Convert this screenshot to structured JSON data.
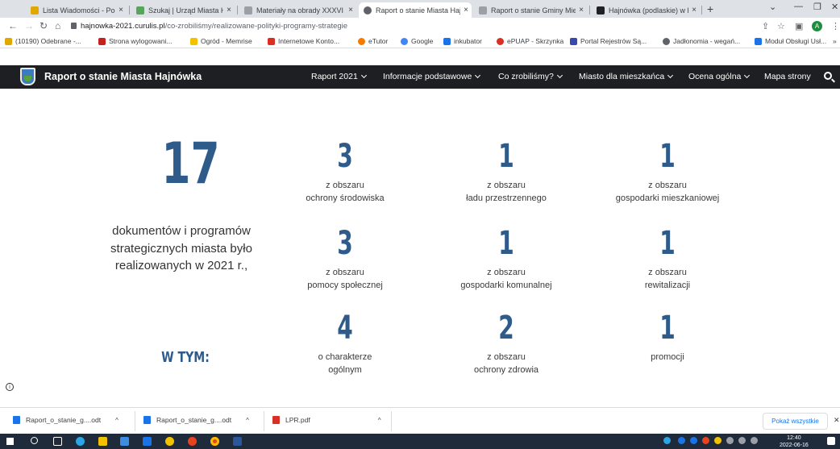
{
  "browser": {
    "tabs": [
      {
        "label": "Lista Wiadomości - Poczta",
        "icon": "mail-icon",
        "color": "#e0a800"
      },
      {
        "label": "Szukaj | Urząd Miasta Hajnó",
        "icon": "crest-icon",
        "color": "#58a55c"
      },
      {
        "label": "Materiały na obrady XXXVI",
        "icon": "document-icon",
        "color": "#5f6368"
      },
      {
        "label": "Raport o stanie Miasta Haj",
        "icon": "globe-icon",
        "color": "#5f6368"
      },
      {
        "label": "Raport o stanie Gminy Mie",
        "icon": "document-icon",
        "color": "#5f6368"
      },
      {
        "label": "Hajnówka (podlaskie) w licz",
        "icon": "chart-icon",
        "color": "#202124"
      }
    ],
    "url_host": "hajnowka-2021.curulis.pl",
    "url_path": "/co-zrobiliśmy/realizowane-polityki-programy-strategie",
    "avatar_letter": "A",
    "bookmarks": [
      {
        "label": "(10190) Odebrane -...",
        "color": "#e0a800"
      },
      {
        "label": "Strona wylogowani...",
        "color": "#c5221f"
      },
      {
        "label": "Ogród - Memrise",
        "color": "#f2c200"
      },
      {
        "label": "Internetowe Konto...",
        "color": "#d93025"
      },
      {
        "label": "eTutor",
        "color": "#f57c00"
      },
      {
        "label": "Google",
        "color": "#4285f4"
      },
      {
        "label": "inkubator",
        "color": "#1a73e8"
      },
      {
        "label": "ePUAP - Skrzynka",
        "color": "#d93025"
      },
      {
        "label": "Portal Rejestrów Są...",
        "color": "#3949ab"
      },
      {
        "label": "Jadłonomia - wegań...",
        "color": "#5f6368"
      },
      {
        "label": "Moduł Obsługi Usł...",
        "color": "#1a73e8"
      }
    ],
    "more_bookmarks": "»"
  },
  "site": {
    "title": "Raport o stanie Miasta Hajnówka",
    "menu": [
      {
        "label": "Raport 2021",
        "dropdown": true
      },
      {
        "label": "Informacje podstawowe",
        "dropdown": true
      },
      {
        "label": "Co zrobiliśmy?",
        "dropdown": true
      },
      {
        "label": "Miasto dla mieszkańca",
        "dropdown": true
      },
      {
        "label": "Ocena ogólna",
        "dropdown": true
      },
      {
        "label": "Mapa strony",
        "dropdown": false
      }
    ]
  },
  "summary": {
    "total": "17",
    "description": "dokumentów i programów strategicznych miasta było realizowanych w 2021 r.,",
    "including": "W TYM:"
  },
  "areas": [
    {
      "count": "3",
      "line1": "z obszaru",
      "line2": "ochrony środowiska"
    },
    {
      "count": "1",
      "line1": "z obszaru",
      "line2": "ładu przestrzennego"
    },
    {
      "count": "1",
      "line1": "z obszaru",
      "line2": "gospodarki mieszkaniowej"
    },
    {
      "count": "3",
      "line1": "z obszaru",
      "line2": "pomocy społecznej"
    },
    {
      "count": "1",
      "line1": "z obszaru",
      "line2": "gospodarki komunalnej"
    },
    {
      "count": "1",
      "line1": "z obszaru",
      "line2": "rewitalizacji"
    },
    {
      "count": "4",
      "line1": "o charakterze",
      "line2": "ogólnym"
    },
    {
      "count": "2",
      "line1": "z obszaru",
      "line2": "ochrony zdrowia"
    },
    {
      "count": "1",
      "line1": "promocji",
      "line2": ""
    }
  ],
  "downloads": {
    "items": [
      {
        "name": "Raport_o_stanie_g....odt",
        "icon": "odt-file-icon",
        "color": "#1a73e8"
      },
      {
        "name": "Raport_o_stanie_g....odt",
        "icon": "odt-file-icon",
        "color": "#1a73e8"
      },
      {
        "name": "LPR.pdf",
        "icon": "pdf-file-icon",
        "color": "#d93025"
      }
    ],
    "show_all": "Pokaż wszystkie",
    "close": "✕"
  },
  "taskbar": {
    "time": "12:40",
    "date": "2022-06-16"
  },
  "colors": {
    "accent": "#2e5b8a",
    "nav_bg": "#1d1f22"
  }
}
